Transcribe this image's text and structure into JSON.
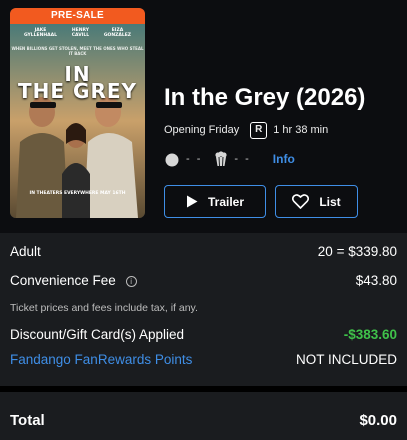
{
  "poster": {
    "badge": "PRE-SALE",
    "cast": [
      "JAKE GYLLENHAAL",
      "HENRY CAVILL",
      "EIZA GONZÁLEZ"
    ],
    "tagline": "WHEN BILLIONS GET STOLEN, MEET THE ONES WHO STEAL IT BACK",
    "title_line1": "IN",
    "title_line2": "THE GREY",
    "release": "IN THEATERS EVERYWHERE MAY 16TH"
  },
  "movie": {
    "title": "In the Grey (2026)",
    "opening": "Opening Friday",
    "rating": "R",
    "runtime": "1 hr 38 min",
    "tomatometer": "- -",
    "audience_score": "- -",
    "info_link": "Info"
  },
  "buttons": {
    "trailer": "Trailer",
    "list": "List"
  },
  "summary": {
    "adult_label": "Adult",
    "adult_value": "20 = $339.80",
    "fee_label": "Convenience Fee",
    "fee_info_glyph": "i",
    "fee_value": "$43.80",
    "note": "Ticket prices and fees include tax, if any.",
    "discount_label": "Discount/Gift Card(s) Applied",
    "discount_value": "-$383.60",
    "rewards_label": "Fandango FanRewards Points",
    "rewards_value": "NOT INCLUDED",
    "total_label": "Total",
    "total_value": "$0.00"
  },
  "colors": {
    "accent_blue": "#3f8ee6",
    "presale_orange": "#f25a1f",
    "discount_green": "#3fc24a",
    "summary_bg": "#1a1c1f"
  },
  "icons": [
    "play-icon",
    "heart-icon",
    "tomato-icon",
    "popcorn-icon",
    "info-circle-icon"
  ]
}
